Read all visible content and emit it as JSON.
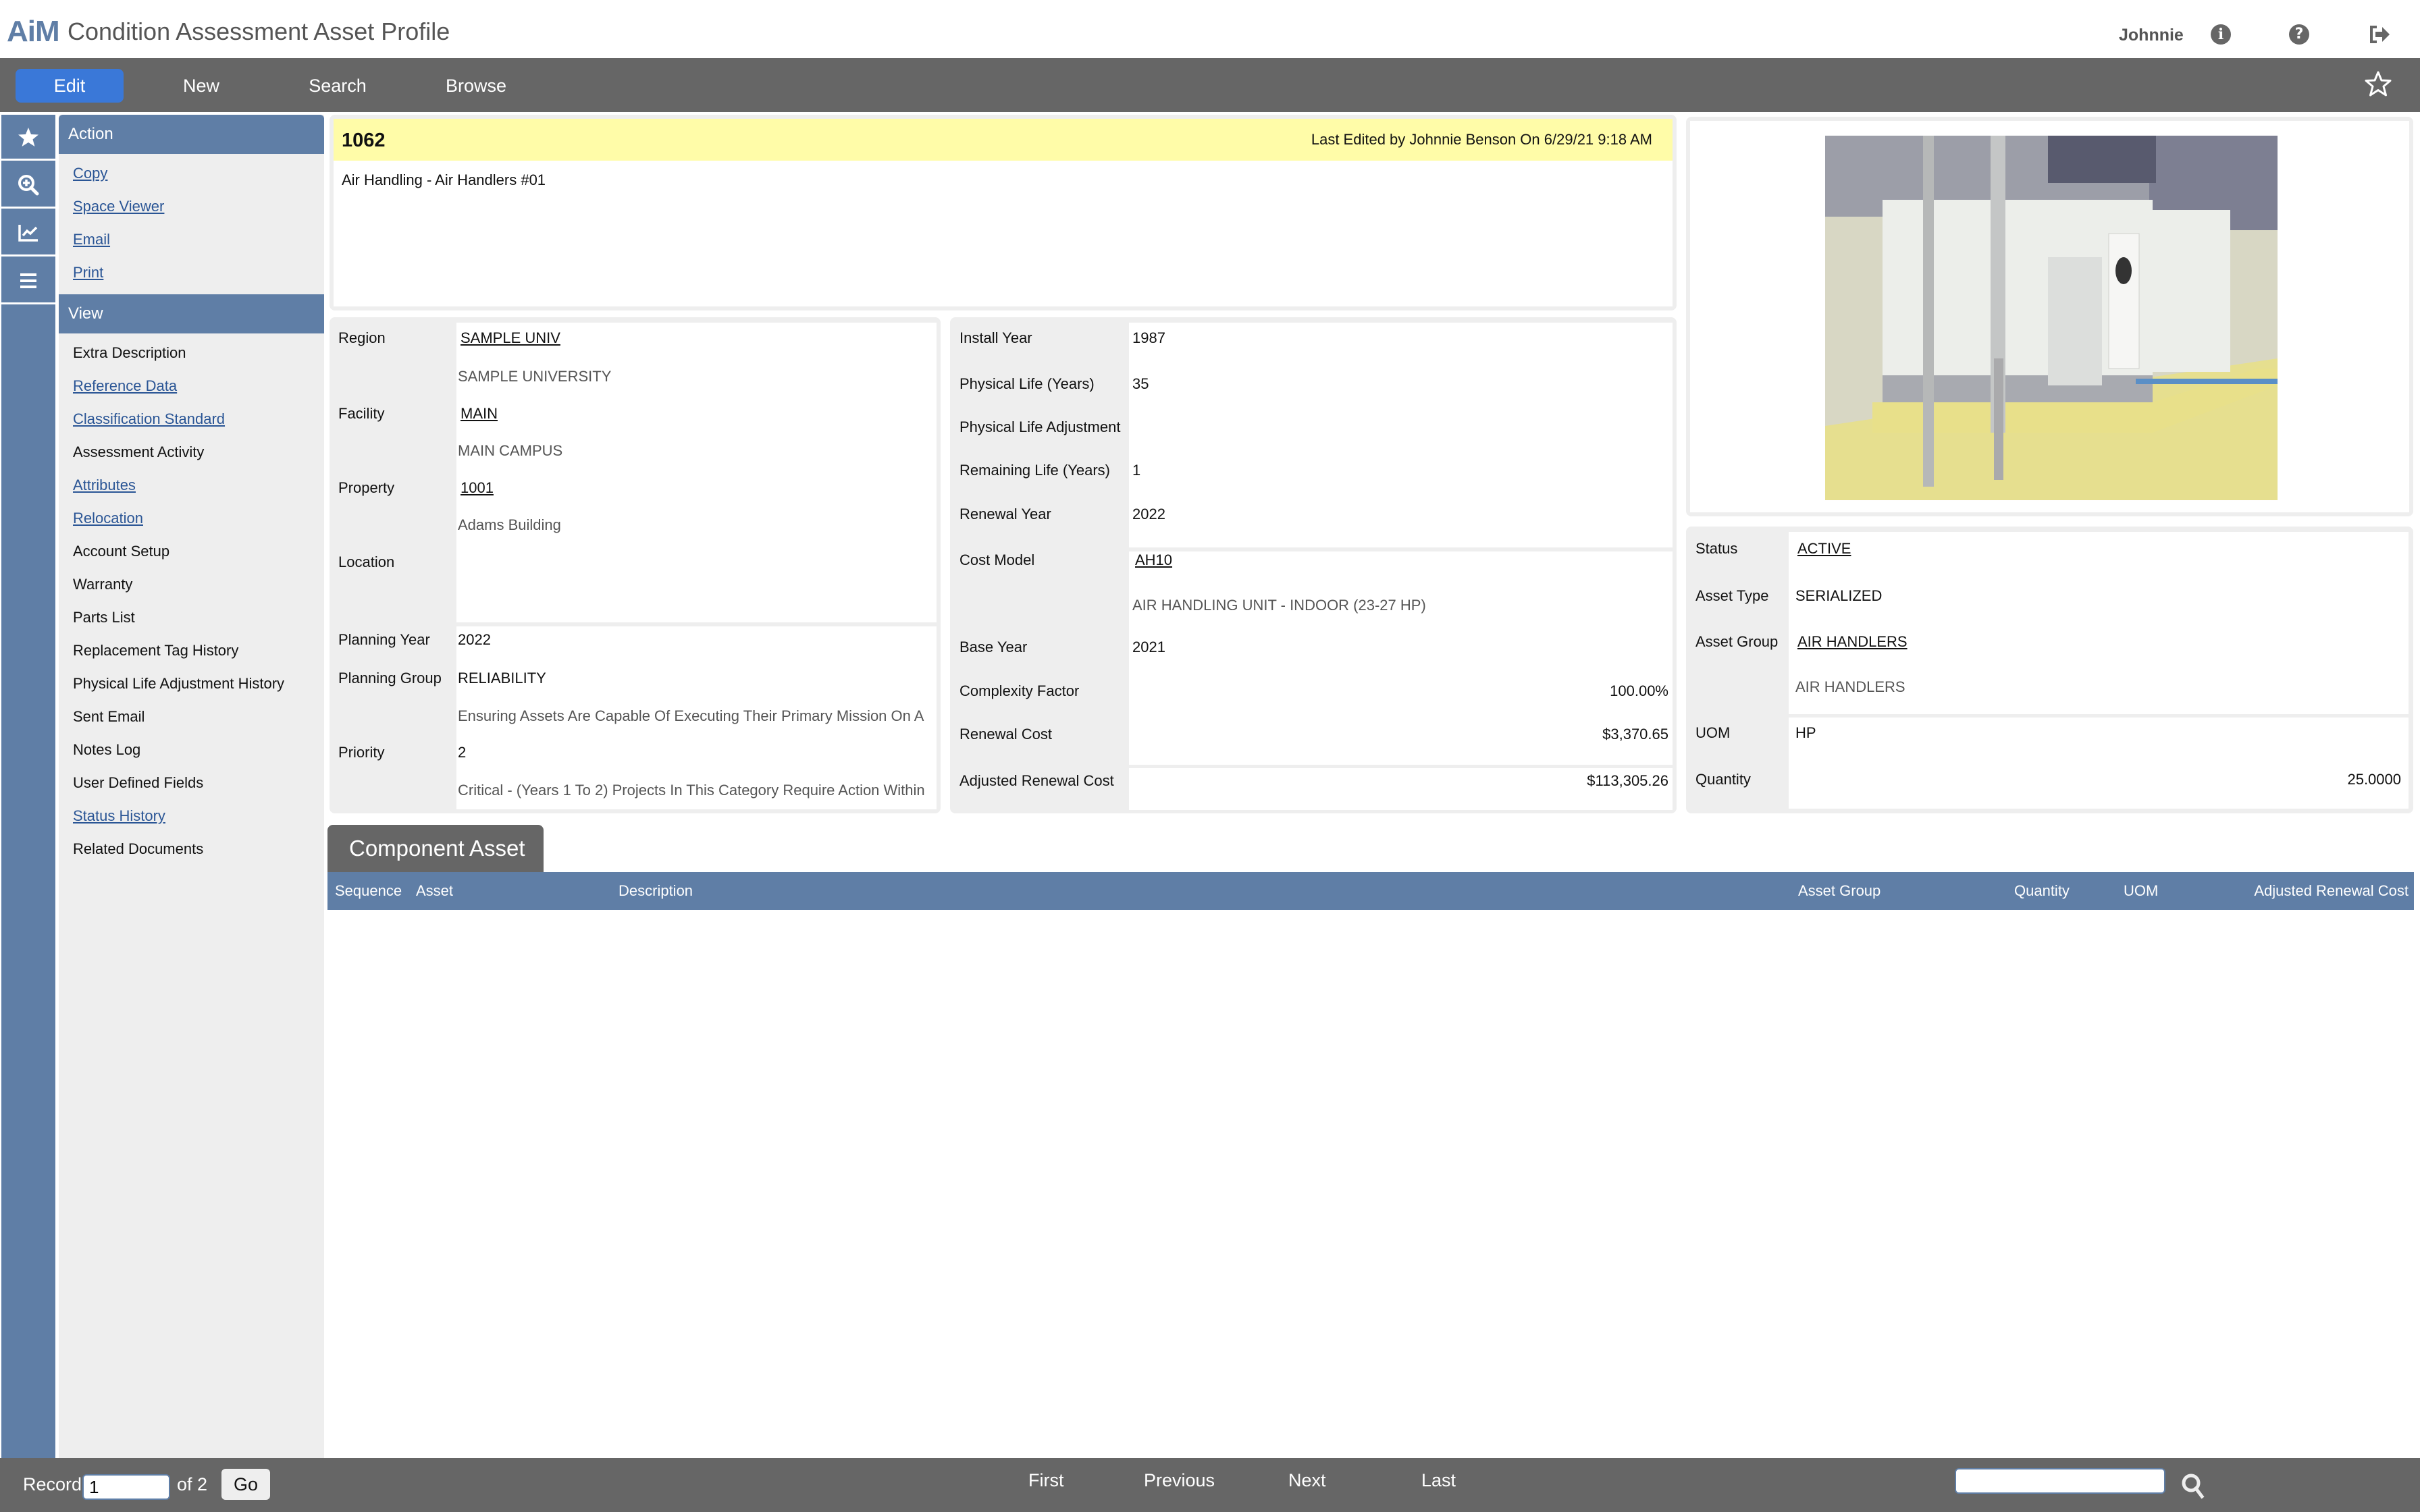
{
  "app": {
    "logo": "AiM",
    "title": "Condition Assessment Asset Profile",
    "user": "Johnnie"
  },
  "toolbar": {
    "buttons": [
      {
        "label": "Edit",
        "active": true
      },
      {
        "label": "New"
      },
      {
        "label": "Search"
      },
      {
        "label": "Browse"
      }
    ]
  },
  "rail": {
    "icons": [
      "favorites-star-icon",
      "zoom-search-icon",
      "chart-icon",
      "menu-icon"
    ]
  },
  "sidebar": {
    "action": {
      "title": "Action",
      "items": [
        {
          "label": "Copy",
          "link": true
        },
        {
          "label": "Space Viewer",
          "link": true
        },
        {
          "label": "Email",
          "link": true
        },
        {
          "label": "Print",
          "link": true
        }
      ]
    },
    "view": {
      "title": "View",
      "items": [
        {
          "label": "Extra Description",
          "link": false
        },
        {
          "label": "Reference Data",
          "link": true
        },
        {
          "label": "Classification Standard",
          "link": true
        },
        {
          "label": "Assessment Activity",
          "link": false
        },
        {
          "label": "Attributes",
          "link": true
        },
        {
          "label": "Relocation",
          "link": true
        },
        {
          "label": "Account Setup",
          "link": false
        },
        {
          "label": "Warranty",
          "link": false
        },
        {
          "label": "Parts List",
          "link": false
        },
        {
          "label": "Replacement Tag History",
          "link": false
        },
        {
          "label": "Physical Life Adjustment History",
          "link": false
        },
        {
          "label": "Sent Email",
          "link": false
        },
        {
          "label": "Notes Log",
          "link": false
        },
        {
          "label": "User Defined Fields",
          "link": false
        },
        {
          "label": "Status History",
          "link": true
        },
        {
          "label": "Related Documents",
          "link": false
        }
      ]
    }
  },
  "record": {
    "id": "1062",
    "last_edited": "Last Edited by Johnnie Benson On 6/29/21 9:18 AM",
    "description": "Air Handling - Air Handlers #01"
  },
  "location": {
    "region_label": "Region",
    "region": "SAMPLE UNIV",
    "region_desc": "SAMPLE UNIVERSITY",
    "facility_label": "Facility",
    "facility": "MAIN",
    "facility_desc": "MAIN CAMPUS",
    "property_label": "Property",
    "property": "1001",
    "property_desc": "Adams Building",
    "location_label": "Location",
    "location": ""
  },
  "planning": {
    "year_label": "Planning Year",
    "year": "2022",
    "group_label": "Planning Group",
    "group": "RELIABILITY",
    "group_desc": "Ensuring Assets Are Capable Of Executing Their Primary Mission On A",
    "priority_label": "Priority",
    "priority": "2",
    "priority_desc": "Critical - (Years 1 To 2) Projects In This Category Require Action Within"
  },
  "life": {
    "install_year_label": "Install Year",
    "install_year": "1987",
    "physical_life_label": "Physical Life (Years)",
    "physical_life": "35",
    "adjustment_label": "Physical Life Adjustment",
    "adjustment": "",
    "remaining_label": "Remaining Life (Years)",
    "remaining": "1",
    "renewal_year_label": "Renewal Year",
    "renewal_year": "2022"
  },
  "cost": {
    "model_label": "Cost Model",
    "model": "AH10",
    "model_desc": "AIR HANDLING UNIT - INDOOR (23-27 HP)",
    "base_year_label": "Base Year",
    "base_year": "2021",
    "complexity_label": "Complexity Factor",
    "complexity": "100.00%",
    "renewal_cost_label": "Renewal Cost",
    "renewal_cost": "$3,370.65",
    "adjusted_label": "Adjusted Renewal Cost",
    "adjusted": "$113,305.26"
  },
  "status": {
    "status_label": "Status",
    "status": "ACTIVE",
    "asset_type_label": "Asset Type",
    "asset_type": "SERIALIZED",
    "asset_group_label": "Asset Group",
    "asset_group": "AIR HANDLERS",
    "asset_group_desc": "AIR HANDLERS",
    "uom_label": "UOM",
    "uom": "HP",
    "quantity_label": "Quantity",
    "quantity": "25.0000"
  },
  "component": {
    "tab": "Component Asset",
    "columns": [
      "Sequence",
      "Asset",
      "Description",
      "Asset Group",
      "Quantity",
      "UOM",
      "Adjusted Renewal Cost"
    ],
    "rows": []
  },
  "footer": {
    "record_label": "Record",
    "record_value": "1",
    "of_label": "of 2",
    "go": "Go",
    "nav": [
      "First",
      "Previous",
      "Next",
      "Last"
    ],
    "search_value": ""
  },
  "colors": {
    "accent": "#5f7ea6",
    "active_button": "#3a78d8",
    "bar": "#666666",
    "highlight": "#fffca8",
    "link": "#2a5595"
  }
}
